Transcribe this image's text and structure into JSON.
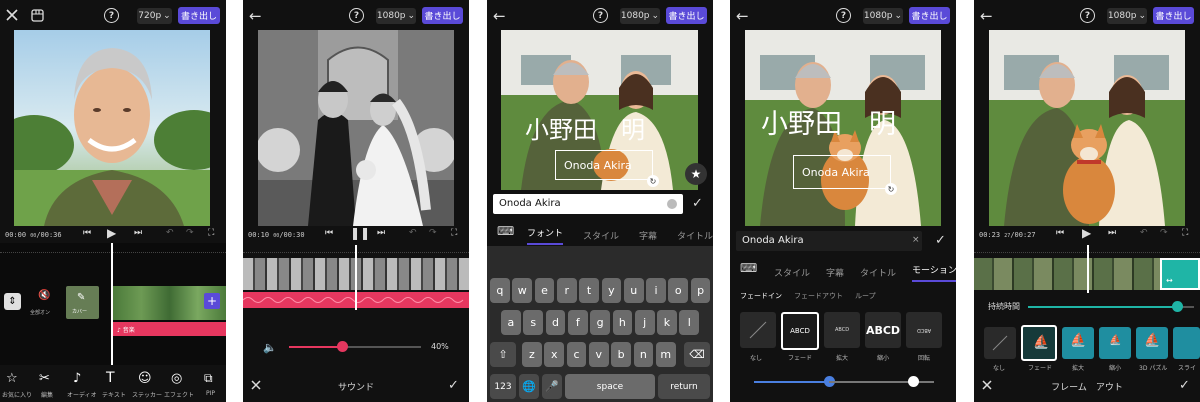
{
  "common": {
    "export_label": "書き出し",
    "help_glyph": "?"
  },
  "p1": {
    "resolution": "720p",
    "timecode": "00:00",
    "timecode_sub": "00",
    "duration": "/00:36",
    "mute_label": "全部オン",
    "cover_label": "カバー",
    "audio_track_label": "♪ 音楽",
    "toolbar": [
      {
        "icon": "favorite-icon",
        "label": "お気に入り"
      },
      {
        "icon": "cut-icon",
        "label": "編集"
      },
      {
        "icon": "audio-icon",
        "label": "オーディオ"
      },
      {
        "icon": "text-icon",
        "label": "テキスト"
      },
      {
        "icon": "sticker-icon",
        "label": "ステッカー"
      },
      {
        "icon": "effect-icon",
        "label": "エフェクト"
      },
      {
        "icon": "pip-icon",
        "label": "PIP"
      }
    ]
  },
  "p2": {
    "resolution": "1080p",
    "timecode": "00:10",
    "timecode_sub": "00",
    "duration": "/00:30",
    "volume_percent": "40%",
    "volume_level": 0.4,
    "title": "サウンド"
  },
  "p3": {
    "resolution": "1080p",
    "caption_name": "小野田　明",
    "caption_romaji": "Onoda  Akira",
    "input_value": "Onoda  Akira",
    "tabs": [
      "フォント",
      "スタイル",
      "字幕",
      "タイトル"
    ],
    "keyboard": {
      "row1": [
        "q",
        "w",
        "e",
        "r",
        "t",
        "y",
        "u",
        "i",
        "o",
        "p"
      ],
      "row2": [
        "a",
        "s",
        "d",
        "f",
        "g",
        "h",
        "j",
        "k",
        "l"
      ],
      "row3": [
        "z",
        "x",
        "c",
        "v",
        "b",
        "n",
        "m"
      ],
      "num_key": "123",
      "space_key": "space",
      "return_key": "return"
    }
  },
  "p4": {
    "resolution": "1080p",
    "caption_name": "小野田　明",
    "caption_romaji": "Onoda  Akira",
    "input_value": "Onoda  Akira",
    "tabs": [
      "スタイル",
      "字幕",
      "タイトル",
      "モーション"
    ],
    "subtabs": [
      "フェードイン",
      "フェードアウト",
      "ループ"
    ],
    "effects": [
      {
        "preview": "",
        "label": "なし"
      },
      {
        "preview": "ABCD",
        "label": "フェード"
      },
      {
        "preview": "ABCD",
        "label": "拡大"
      },
      {
        "preview": "ABCD",
        "label": "縮小"
      },
      {
        "preview": "ABCD",
        "label": "回転"
      }
    ],
    "slider1_level": 0.25,
    "slider2_level": 0.8
  },
  "p5": {
    "resolution": "1080p",
    "timecode": "00:23",
    "timecode_sub": "27",
    "duration": "/00:27",
    "duration_label": "持続時間",
    "duration_level": 0.9,
    "title": "フレーム　アウト",
    "effects": [
      {
        "label": "なし"
      },
      {
        "label": "フェード"
      },
      {
        "label": "拡大"
      },
      {
        "label": "縮小"
      },
      {
        "label": "3D パズル"
      },
      {
        "label": "スライ"
      }
    ]
  },
  "colors": {
    "accent": "#5a4ad8",
    "audio_track": "#e6375f",
    "teal": "#1fb5a6",
    "slider_blue": "#4a7fe0"
  }
}
